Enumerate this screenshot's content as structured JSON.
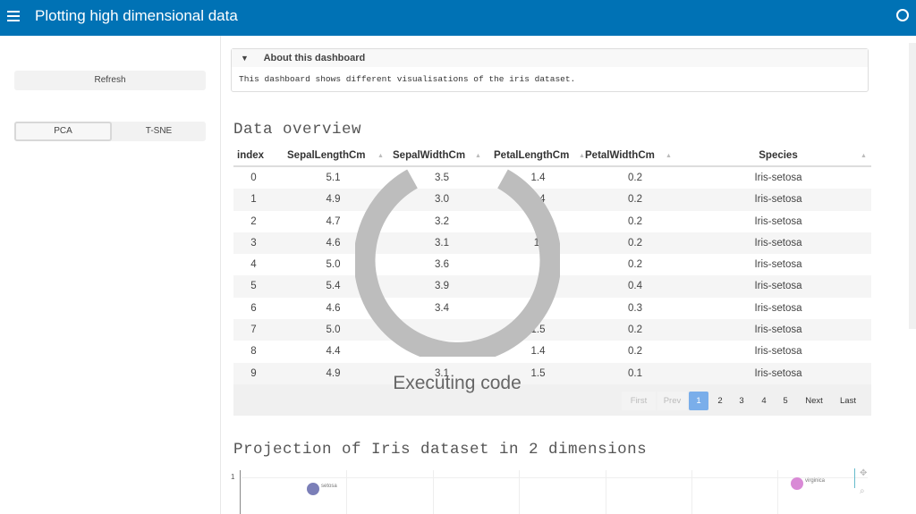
{
  "header": {
    "title": "Plotting high dimensional data"
  },
  "sidebar": {
    "refresh_label": "Refresh",
    "toggle": [
      "PCA",
      "T-SNE"
    ]
  },
  "about": {
    "title": "About this dashboard",
    "text": "This dashboard shows different visualisations of the iris dataset."
  },
  "sections": {
    "overview": "Data overview",
    "projection": "Projection of Iris dataset in 2 dimensions"
  },
  "table": {
    "columns": [
      "index",
      "SepalLengthCm",
      "SepalWidthCm",
      "PetalLengthCm",
      "PetalWidthCm",
      "Species"
    ],
    "rows": [
      [
        "0",
        "5.1",
        "3.5",
        "1.4",
        "0.2",
        "Iris-setosa"
      ],
      [
        "1",
        "4.9",
        "3.0",
        "1.4",
        "0.2",
        "Iris-setosa"
      ],
      [
        "2",
        "4.7",
        "3.2",
        "",
        "0.2",
        "Iris-setosa"
      ],
      [
        "3",
        "4.6",
        "3.1",
        "1.",
        "0.2",
        "Iris-setosa"
      ],
      [
        "4",
        "5.0",
        "3.6",
        "",
        "0.2",
        "Iris-setosa"
      ],
      [
        "5",
        "5.4",
        "3.9",
        "",
        "0.4",
        "Iris-setosa"
      ],
      [
        "6",
        "4.6",
        "3.4",
        "",
        "0.3",
        "Iris-setosa"
      ],
      [
        "7",
        "5.0",
        "",
        "1.5",
        "0.2",
        "Iris-setosa"
      ],
      [
        "8",
        "4.4",
        "",
        "1.4",
        "0.2",
        "Iris-setosa"
      ],
      [
        "9",
        "4.9",
        "3.1",
        "1.5",
        "0.1",
        "Iris-setosa"
      ]
    ]
  },
  "pager": {
    "first": "First",
    "prev": "Prev",
    "pages": [
      "1",
      "2",
      "3",
      "4",
      "5"
    ],
    "current": "1",
    "next": "Next",
    "last": "Last"
  },
  "plot": {
    "y_tick": "1",
    "labels": [
      "setosa",
      "virginica"
    ],
    "colors": {
      "setosa": "#7b7fb8",
      "virginica": "#d98ad6"
    }
  },
  "overlay": {
    "text": "Executing code"
  },
  "colors": {
    "header": "#0072b5",
    "page_active": "#7aaeea"
  }
}
